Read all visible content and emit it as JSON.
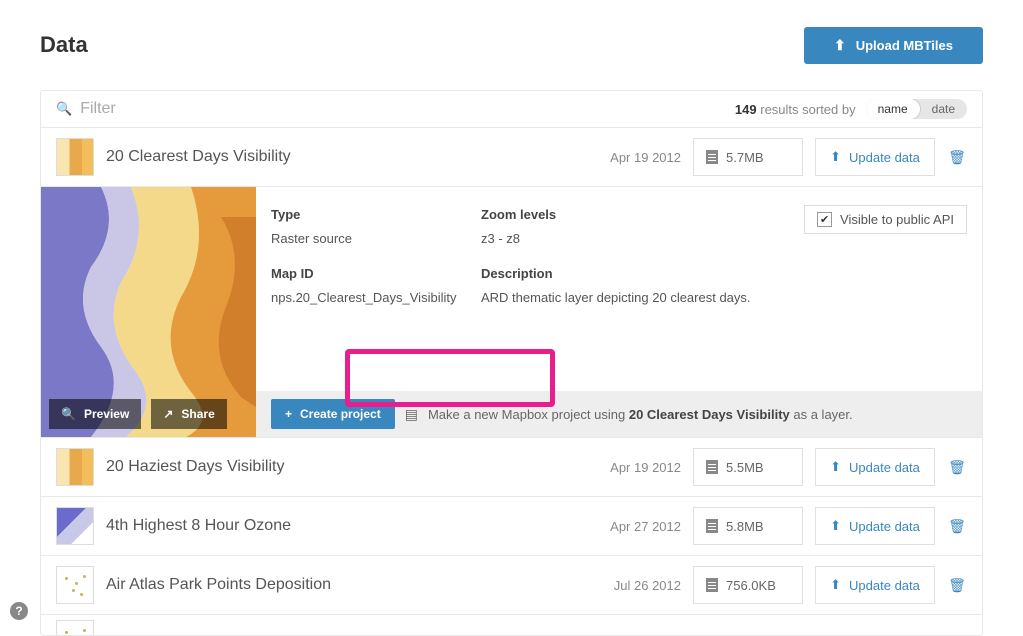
{
  "header": {
    "title": "Data",
    "upload_label": "Upload MBTiles"
  },
  "filter": {
    "placeholder": "Filter",
    "result_count": "149",
    "sorted_by_text": "results sorted by",
    "sort_name": "name",
    "sort_date": "date"
  },
  "expanded": {
    "type_label": "Type",
    "type_value": "Raster source",
    "mapid_label": "Map ID",
    "mapid_value": "nps.20_Clearest_Days_Visibility",
    "zoom_label": "Zoom levels",
    "zoom_value": "z3 - z8",
    "desc_label": "Description",
    "desc_value": "ARD thematic layer depicting 20 clearest days.",
    "visible_label": "Visible to public API",
    "preview_label": "Preview",
    "share_label": "Share",
    "create_label": "Create project",
    "helper_prefix": "Make a new Mapbox project using ",
    "helper_strong": "20 Clearest Days Visibility",
    "helper_suffix": " as a layer."
  },
  "rows": [
    {
      "title": "20 Clearest Days Visibility",
      "date": "Apr 19 2012",
      "size": "5.7MB",
      "update": "Update data"
    },
    {
      "title": "20 Haziest Days Visibility",
      "date": "Apr 19 2012",
      "size": "5.5MB",
      "update": "Update data"
    },
    {
      "title": "4th Highest 8 Hour Ozone",
      "date": "Apr 27 2012",
      "size": "5.8MB",
      "update": "Update data"
    },
    {
      "title": "Air Atlas Park Points Deposition",
      "date": "Jul 26 2012",
      "size": "756.0KB",
      "update": "Update data"
    }
  ],
  "help": "?"
}
